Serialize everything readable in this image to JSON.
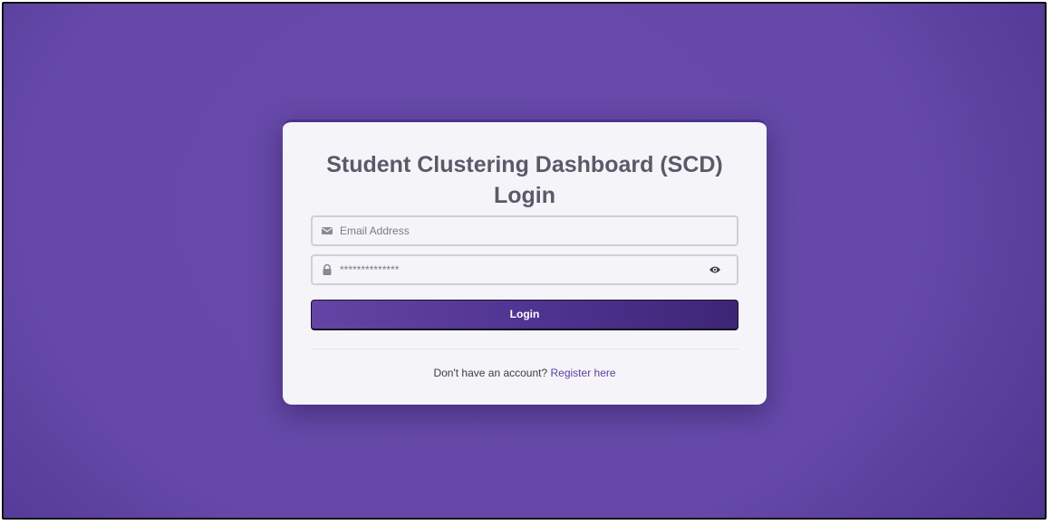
{
  "login_card": {
    "title": "Student Clustering Dashboard (SCD)",
    "subtitle": "Login",
    "email_field": {
      "icon": "envelope-icon",
      "placeholder": "Email Address"
    },
    "password_field": {
      "icon": "lock-icon",
      "value": "**************",
      "toggle_icon": "eye-icon"
    },
    "login_button_label": "Login",
    "register_prompt": "Don't have an account?",
    "register_link": "Register here"
  },
  "colors": {
    "background": "#6548a8",
    "accent": "#4e3390",
    "link": "#5a3fa0",
    "card": "#f5f4f9"
  }
}
